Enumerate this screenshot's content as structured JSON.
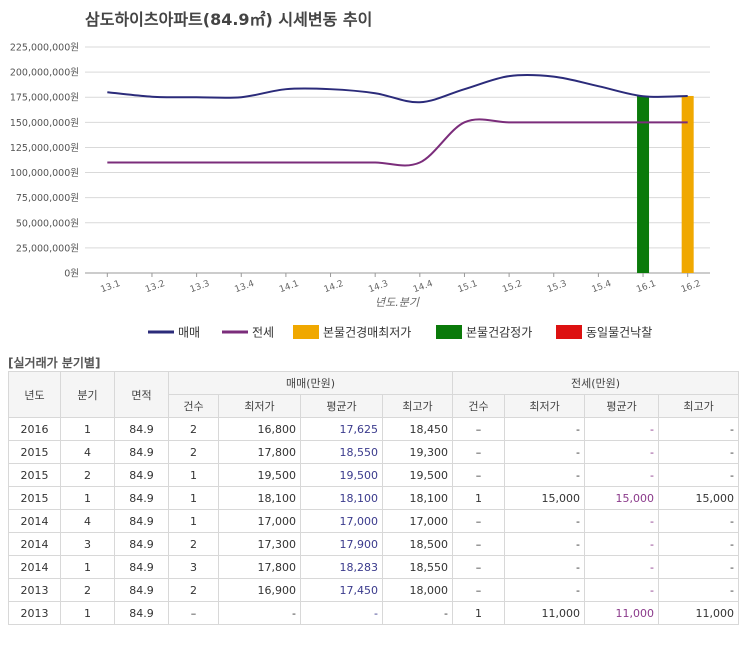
{
  "chart_data": {
    "type": "line",
    "title": "삼도하이츠아파트(84.9㎡) 시세변동 추이",
    "xlabel": "년도.분기",
    "categories": [
      "13.1",
      "13.2",
      "13.3",
      "13.4",
      "14.1",
      "14.2",
      "14.3",
      "14.4",
      "15.1",
      "15.2",
      "15.3",
      "15.4",
      "16.1",
      "16.2"
    ],
    "yticks": [
      "225,000,000원",
      "200,000,000원",
      "175,000,000원",
      "150,000,000원",
      "125,000,000원",
      "100,000,000원",
      "75,000,000원",
      "50,000,000원",
      "25,000,000원",
      "0원"
    ],
    "ylim": [
      0,
      225000000
    ],
    "grid": true,
    "legend_position": "bottom",
    "series": [
      {
        "name": "매매",
        "kind": "line",
        "color": "#2b2b7a",
        "values": [
          180000000,
          175500000,
          175000000,
          175000000,
          183000000,
          183000000,
          179000000,
          170000000,
          183000000,
          196000000,
          195500000,
          186000000,
          176000000,
          176250000
        ]
      },
      {
        "name": "전세",
        "kind": "line",
        "color": "#7b2d7b",
        "values": [
          110000000,
          110000000,
          110000000,
          110000000,
          110000000,
          110000000,
          110000000,
          110000000,
          150000000,
          150000000,
          150000000,
          150000000,
          150000000,
          150000000
        ]
      },
      {
        "name": "본물건경매최저가",
        "kind": "bar",
        "color": "#f0a800",
        "values": [
          null,
          null,
          null,
          null,
          null,
          null,
          null,
          null,
          null,
          null,
          null,
          null,
          null,
          176250000
        ]
      },
      {
        "name": "본물건감정가",
        "kind": "bar",
        "color": "#0a7a0a",
        "values": [
          null,
          null,
          null,
          null,
          null,
          null,
          null,
          null,
          null,
          null,
          null,
          null,
          176250000,
          null
        ]
      },
      {
        "name": "동일물건낙찰",
        "kind": "bar",
        "color": "#dd1111",
        "values": [
          null,
          null,
          null,
          null,
          null,
          null,
          null,
          null,
          null,
          null,
          null,
          null,
          null,
          null
        ]
      }
    ]
  },
  "table": {
    "section_title": "[실거래가 분기별]",
    "headers": {
      "year": "년도",
      "quarter": "분기",
      "area": "면적",
      "sale_group": "매매(만원)",
      "jeonse_group": "전세(만원)",
      "count": "건수",
      "min": "최저가",
      "avg": "평균가",
      "max": "최고가"
    },
    "rows": [
      [
        "2016",
        "1",
        "84.9",
        "2",
        "16,800",
        "17,625",
        "18,450",
        "–",
        "-",
        "-",
        "-"
      ],
      [
        "2015",
        "4",
        "84.9",
        "2",
        "17,800",
        "18,550",
        "19,300",
        "–",
        "-",
        "-",
        "-"
      ],
      [
        "2015",
        "2",
        "84.9",
        "1",
        "19,500",
        "19,500",
        "19,500",
        "–",
        "-",
        "-",
        "-"
      ],
      [
        "2015",
        "1",
        "84.9",
        "1",
        "18,100",
        "18,100",
        "18,100",
        "1",
        "15,000",
        "15,000",
        "15,000"
      ],
      [
        "2014",
        "4",
        "84.9",
        "1",
        "17,000",
        "17,000",
        "17,000",
        "–",
        "-",
        "-",
        "-"
      ],
      [
        "2014",
        "3",
        "84.9",
        "2",
        "17,300",
        "17,900",
        "18,500",
        "–",
        "-",
        "-",
        "-"
      ],
      [
        "2014",
        "1",
        "84.9",
        "3",
        "17,800",
        "18,283",
        "18,550",
        "–",
        "-",
        "-",
        "-"
      ],
      [
        "2013",
        "2",
        "84.9",
        "2",
        "16,900",
        "17,450",
        "18,000",
        "–",
        "-",
        "-",
        "-"
      ],
      [
        "2013",
        "1",
        "84.9",
        "–",
        "-",
        "-",
        "-",
        "1",
        "11,000",
        "11,000",
        "11,000"
      ]
    ]
  }
}
